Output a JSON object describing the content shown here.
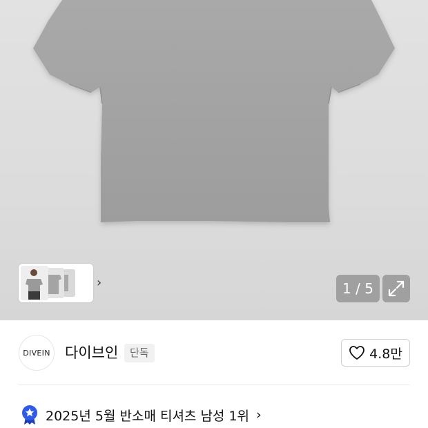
{
  "gallery": {
    "counter": "1 / 5",
    "thumb_chevron_icon": "chevron-right-icon",
    "expand_icon": "expand-arrows-icon"
  },
  "brand": {
    "logo_text": "DIVEIN",
    "name": "다이브인",
    "badge": "단독"
  },
  "likes": {
    "icon": "heart-outline-icon",
    "count": "4.8만"
  },
  "ranking": {
    "icon": "ranking-badge-icon",
    "text": "2025년 5월 반소매 티셔츠 남성 1위",
    "chevron_icon": "chevron-right-icon",
    "badge_color": "#2f5bea"
  }
}
